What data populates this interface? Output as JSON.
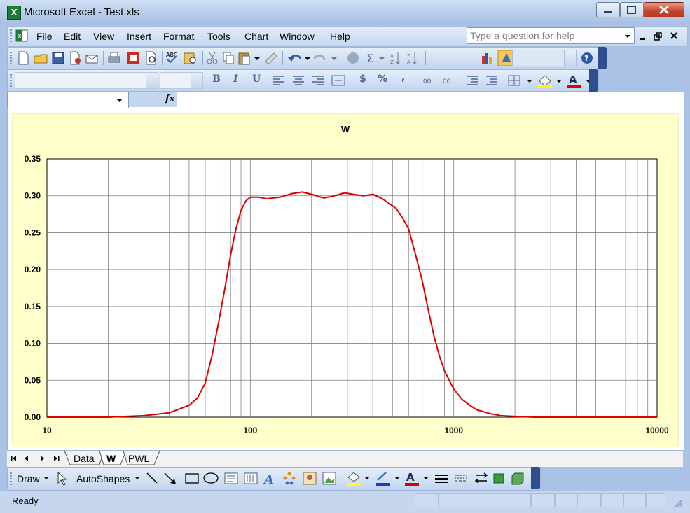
{
  "window": {
    "title": "Microsoft Excel - Test.xls"
  },
  "menu": {
    "items": [
      "File",
      "Edit",
      "View",
      "Insert",
      "Format",
      "Tools",
      "Chart",
      "Window",
      "Help"
    ],
    "help_placeholder": "Type a question for help"
  },
  "formatting": {
    "bold": "B",
    "italic": "I",
    "underline": "U",
    "currency": "$",
    "percent": "%",
    "comma": ","
  },
  "formula_bar": {
    "fx_label": "fx"
  },
  "sheet_tabs": [
    "Data",
    "W",
    "PWL"
  ],
  "active_tab": "W",
  "draw_toolbar": {
    "draw_label": "Draw",
    "autoshapes_label": "AutoShapes"
  },
  "status": {
    "text": "Ready"
  },
  "chart_data": {
    "type": "line",
    "title": "W",
    "xlabel": "",
    "ylabel": "",
    "x_scale": "log",
    "xlim": [
      10,
      10000
    ],
    "ylim": [
      0,
      0.35
    ],
    "x_ticks": [
      10,
      100,
      1000,
      10000
    ],
    "x_tick_labels": [
      "10",
      "100",
      "1000",
      "10000"
    ],
    "y_ticks": [
      0,
      0.05,
      0.1,
      0.15,
      0.2,
      0.25,
      0.3,
      0.35
    ],
    "y_tick_labels": [
      "0.00",
      "0.05",
      "0.10",
      "0.15",
      "0.20",
      "0.25",
      "0.30",
      "0.35"
    ],
    "grid": true,
    "legend": "none",
    "series": [
      {
        "color": "#dd0000",
        "x": [
          10,
          20,
          30,
          40,
          50,
          55,
          60,
          65,
          70,
          75,
          80,
          85,
          90,
          95,
          100,
          110,
          120,
          140,
          160,
          180,
          200,
          230,
          260,
          290,
          320,
          360,
          400,
          440,
          480,
          520,
          560,
          600,
          650,
          700,
          750,
          800,
          850,
          900,
          1000,
          1100,
          1200,
          1300,
          1500,
          1700,
          2000,
          2500,
          3000,
          5000,
          10000
        ],
        "y": [
          0.0,
          0.0,
          0.002,
          0.006,
          0.016,
          0.026,
          0.046,
          0.085,
          0.13,
          0.175,
          0.22,
          0.255,
          0.28,
          0.293,
          0.298,
          0.298,
          0.296,
          0.298,
          0.303,
          0.305,
          0.302,
          0.297,
          0.3,
          0.304,
          0.302,
          0.3,
          0.302,
          0.297,
          0.29,
          0.283,
          0.27,
          0.255,
          0.22,
          0.185,
          0.145,
          0.11,
          0.083,
          0.063,
          0.038,
          0.024,
          0.016,
          0.01,
          0.005,
          0.002,
          0.001,
          0.0,
          0.0,
          0.0,
          0.0
        ]
      }
    ]
  }
}
